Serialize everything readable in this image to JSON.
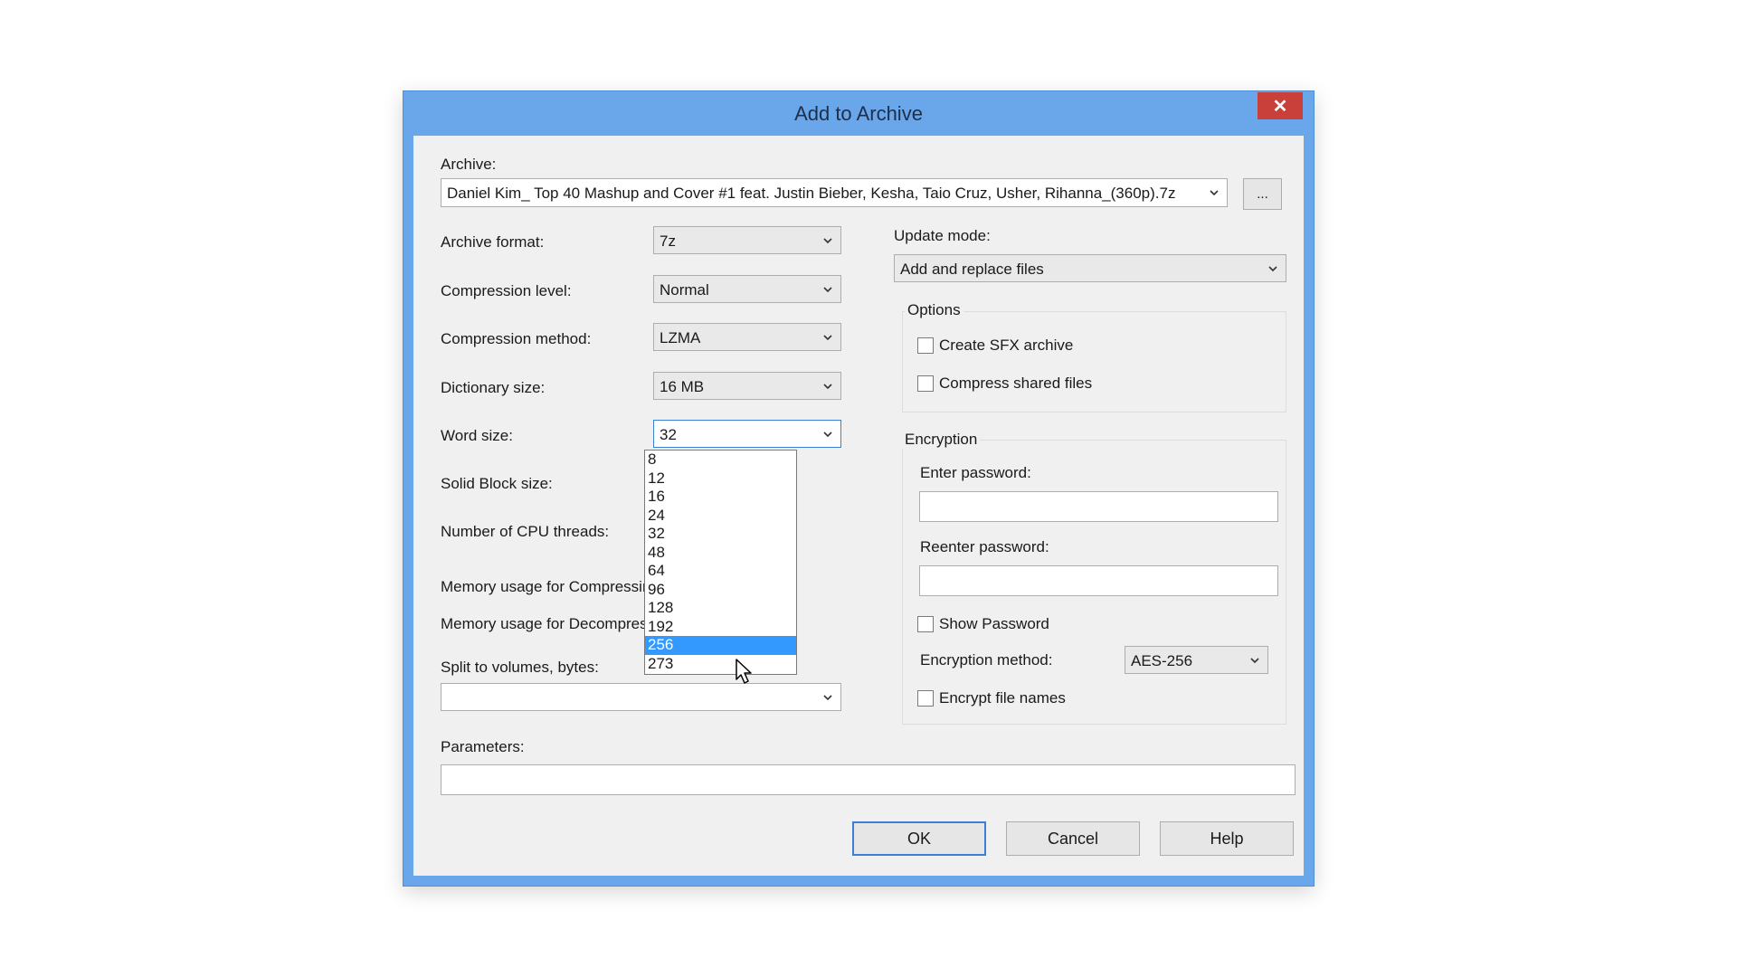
{
  "dialog": {
    "title": "Add to Archive",
    "close_glyph": "✕"
  },
  "archive": {
    "label": "Archive:",
    "path": "Daniel Kim_ Top 40 Mashup and Cover #1 feat. Justin Bieber, Kesha, Taio Cruz, Usher, Rihanna_(360p).7z",
    "browse_label": "..."
  },
  "left": {
    "archive_format": {
      "label": "Archive format:",
      "value": "7z"
    },
    "compression_level": {
      "label": "Compression level:",
      "value": "Normal"
    },
    "compression_method": {
      "label": "Compression method:",
      "value": "LZMA"
    },
    "dictionary_size": {
      "label": "Dictionary size:",
      "value": "16 MB"
    },
    "word_size": {
      "label": "Word size:",
      "value": "32"
    },
    "solid_block_size": {
      "label": "Solid Block size:"
    },
    "cpu_threads": {
      "label": "Number of CPU threads:"
    },
    "mem_compress": {
      "label": "Memory usage for Compressing:"
    },
    "mem_decompress": {
      "label": "Memory usage for Decompressing:"
    },
    "split_volumes": {
      "label": "Split to volumes, bytes:",
      "value": ""
    }
  },
  "word_size_options": [
    "8",
    "12",
    "16",
    "24",
    "32",
    "48",
    "64",
    "96",
    "128",
    "192",
    "256",
    "273"
  ],
  "word_size_highlighted": "256",
  "right": {
    "update_mode": {
      "label": "Update mode:",
      "value": "Add and replace files"
    },
    "options": {
      "title": "Options",
      "create_sfx": "Create SFX archive",
      "compress_shared": "Compress shared files"
    },
    "encryption": {
      "title": "Encryption",
      "enter_password": "Enter password:",
      "reenter_password": "Reenter password:",
      "show_password": "Show Password",
      "method_label": "Encryption method:",
      "method_value": "AES-256",
      "encrypt_names": "Encrypt file names"
    }
  },
  "parameters": {
    "label": "Parameters:",
    "value": ""
  },
  "buttons": {
    "ok": "OK",
    "cancel": "Cancel",
    "help": "Help"
  },
  "colors": {
    "frame": "#6aa7ea",
    "close": "#c9403a",
    "highlight": "#3399ff",
    "client": "#f0f0f0"
  }
}
